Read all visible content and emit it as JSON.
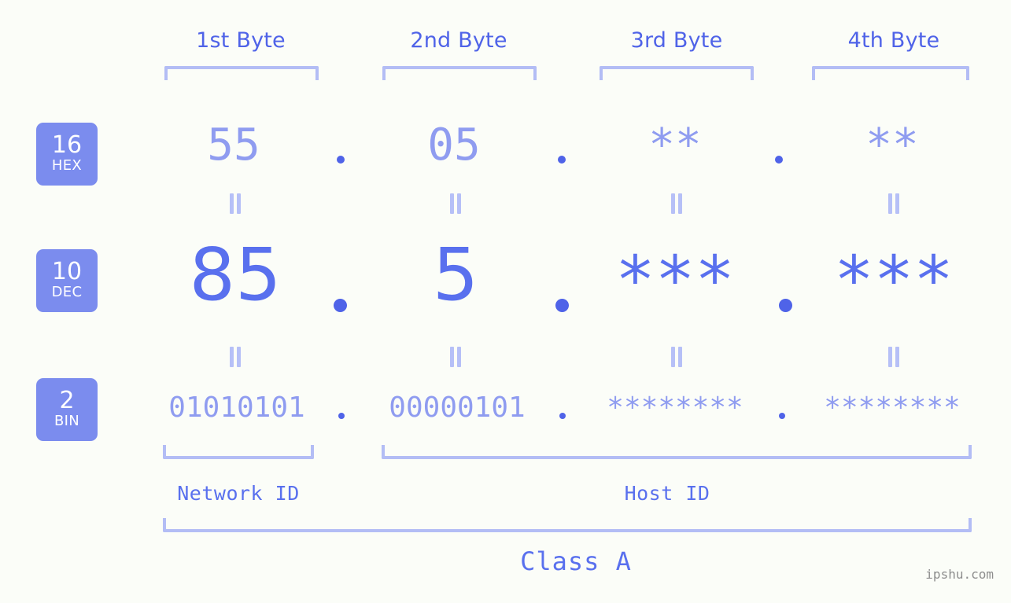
{
  "meta": {
    "background_color": "#fbfdf8",
    "accent_strong": "#4f63e8",
    "accent_mid": "#5970ee",
    "accent_light": "#8f9cf0",
    "bracket_color": "#b3bdf5",
    "badge_color": "#7b8cee",
    "watermark_color": "#8d8d8d"
  },
  "headers": {
    "bytes": [
      {
        "label": "1st Byte"
      },
      {
        "label": "2nd Byte"
      },
      {
        "label": "3rd Byte"
      },
      {
        "label": "4th Byte"
      }
    ]
  },
  "rows": [
    {
      "key": "hex",
      "badge_number": "16",
      "badge_name": "HEX",
      "values": [
        "55",
        "05",
        "**",
        "**"
      ],
      "separator": "."
    },
    {
      "key": "dec",
      "badge_number": "10",
      "badge_name": "DEC",
      "values": [
        "85",
        "5",
        "***",
        "***"
      ],
      "separator": "."
    },
    {
      "key": "bin",
      "badge_number": "2",
      "badge_name": "BIN",
      "values": [
        "01010101",
        "00000101",
        "********",
        "********"
      ],
      "separator": "."
    }
  ],
  "equality_mark": "=",
  "footer": {
    "network_id_label": "Network ID",
    "host_id_label": "Host ID",
    "class_label": "Class A",
    "watermark": "ipshu.com"
  }
}
